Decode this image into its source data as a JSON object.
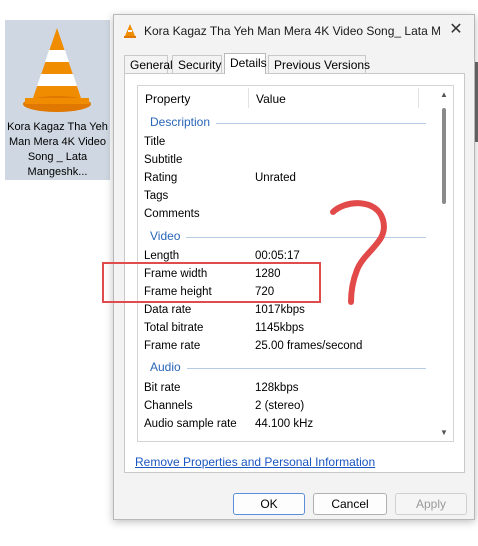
{
  "desktop": {
    "icon": "vlc-cone-icon",
    "file_label": "Kora Kagaz Tha Yeh Man Mera 4K Video Song _ Lata Mangeshk..."
  },
  "dialog": {
    "title": "Kora Kagaz Tha Yeh Man Mera 4K Video Song_ Lata M...",
    "app_icon": "vlc-cone-icon",
    "close_symbol": "✕",
    "tabs": [
      "General",
      "Security",
      "Details",
      "Previous Versions"
    ],
    "active_tab": "Details",
    "columns": {
      "property": "Property",
      "value": "Value"
    },
    "groups": {
      "description": "Description",
      "video": "Video",
      "audio": "Audio"
    },
    "rows": {
      "title": {
        "k": "Title",
        "v": ""
      },
      "subtitle": {
        "k": "Subtitle",
        "v": ""
      },
      "rating": {
        "k": "Rating",
        "v": "Unrated"
      },
      "tags": {
        "k": "Tags",
        "v": ""
      },
      "comments": {
        "k": "Comments",
        "v": ""
      },
      "length": {
        "k": "Length",
        "v": "00:05:17"
      },
      "frame_width": {
        "k": "Frame width",
        "v": "1280"
      },
      "frame_height": {
        "k": "Frame height",
        "v": "720"
      },
      "data_rate": {
        "k": "Data rate",
        "v": "1017kbps"
      },
      "total_bitrate": {
        "k": "Total bitrate",
        "v": "1145kbps"
      },
      "frame_rate": {
        "k": "Frame rate",
        "v": "25.00 frames/second"
      },
      "bit_rate": {
        "k": "Bit rate",
        "v": "128kbps"
      },
      "channels": {
        "k": "Channels",
        "v": "2 (stereo)"
      },
      "audio_sample_rate": {
        "k": "Audio sample rate",
        "v": "44.100 kHz"
      }
    },
    "remove_link": "Remove Properties and Personal Information",
    "buttons": {
      "ok": "OK",
      "cancel": "Cancel",
      "apply": "Apply"
    }
  },
  "annotation": {
    "highlight_color": "#e04b4b",
    "question_mark_color": "#e24a4a"
  }
}
